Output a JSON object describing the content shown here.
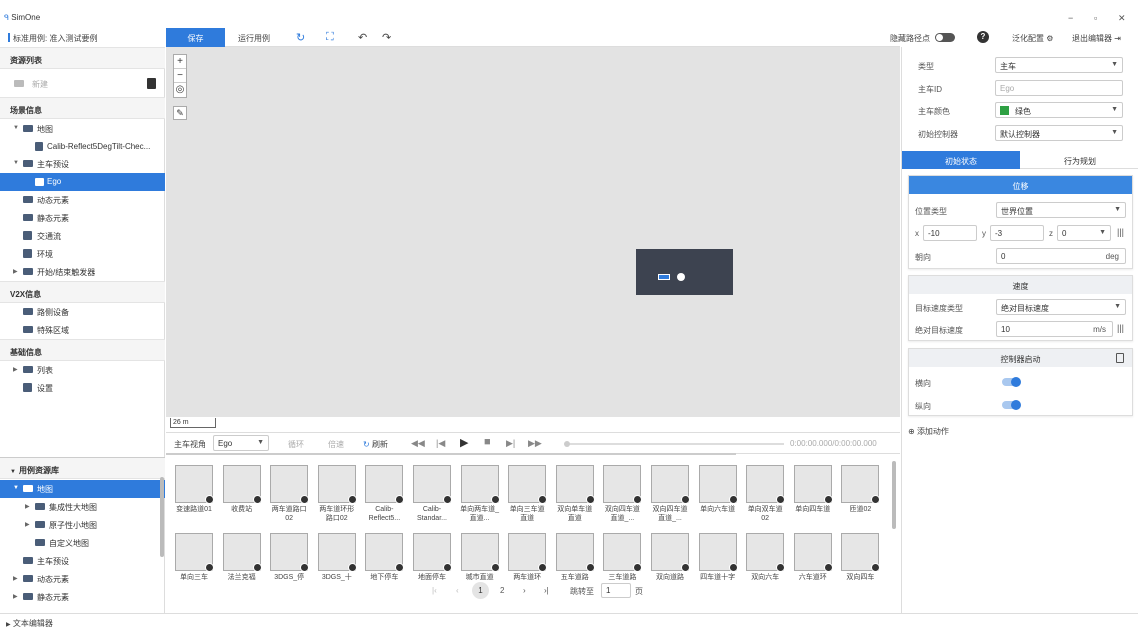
{
  "app": {
    "title": "SimOne",
    "breadcrumb": "标准用例: 准入测试要例"
  },
  "window": {
    "minimize": "−",
    "restore": "▫",
    "close": "✕"
  },
  "toolbar": {
    "save": "保存",
    "run_case": "运行用例"
  },
  "topright": {
    "hide_path_points": "隐藏路径点",
    "help": "?",
    "generalize": "泛化配置",
    "exit": "退出编辑器"
  },
  "sidebar": {
    "resources_title": "资源列表",
    "new": "新建",
    "scene_info": "场景信息",
    "map": "地图",
    "map_file": "Calib-Reflect5DegTilt-Chec...",
    "ego_config": "主车预设",
    "ego": "Ego",
    "dynamic": "动态元素",
    "static": "静态元素",
    "traffic": "交通流",
    "env": "环境",
    "trigger": "开始/结束触发器",
    "v2x": "V2X信息",
    "roadside": "路侧设备",
    "special_zone": "特殊区域",
    "basic": "基础信息",
    "list": "列表",
    "settings": "设置"
  },
  "library": {
    "title": "用例资源库",
    "map": "地图",
    "large_map": "集成性大地图",
    "small_map": "原子性小地图",
    "custom_map": "自定义地图",
    "ego_preset": "主车预设",
    "dynamic": "动态元素",
    "static": "静态元素"
  },
  "player": {
    "main_view_label": "主车视角",
    "main_view_value": "Ego",
    "loop": "循环",
    "speed": "倍速",
    "refresh": "刷新",
    "time": "0:00:00.000/0:00:00.000"
  },
  "scale": "26 m",
  "assets_row1": [
    {
      "label": "变速路道01"
    },
    {
      "label": "收费站"
    },
    {
      "label": "两车道路口02"
    },
    {
      "label": "两车道环形路口02"
    },
    {
      "label": "Calib-Reflect5..."
    },
    {
      "label": "Calib-Standar..."
    },
    {
      "label": "单向两车道_直道..."
    },
    {
      "label": "单向三车道直道"
    },
    {
      "label": "双向单车道直道"
    },
    {
      "label": "双向四车道直道_..."
    },
    {
      "label": "双向四车道直道_..."
    },
    {
      "label": "单向六车道"
    },
    {
      "label": "单向双车道02"
    },
    {
      "label": "单向四车道"
    },
    {
      "label": "匝道02"
    }
  ],
  "assets_row2": [
    {
      "label": "单向三车"
    },
    {
      "label": "法兰克福"
    },
    {
      "label": "3DGS_停"
    },
    {
      "label": "3DGS_十"
    },
    {
      "label": "地下停车"
    },
    {
      "label": "地面停车"
    },
    {
      "label": "城市直道"
    },
    {
      "label": "两车道环"
    },
    {
      "label": "五车道路"
    },
    {
      "label": "三车道路"
    },
    {
      "label": "双向道路"
    },
    {
      "label": "四车道十字"
    },
    {
      "label": "双向六车"
    },
    {
      "label": "六车道环"
    },
    {
      "label": "双向四车"
    }
  ],
  "pager": {
    "first": "|‹",
    "prev": "‹",
    "page1": "1",
    "page2": "2",
    "next": "›",
    "last": "›|",
    "jump_label": "跳转至",
    "jump_value": "1",
    "page_unit": "页"
  },
  "right": {
    "type_label": "类型",
    "type_value": "主车",
    "id_label": "主车ID",
    "id_placeholder": "Ego",
    "color_label": "主车颜色",
    "color_value": "绿色",
    "color_hex": "#2ea043",
    "controller_label": "初始控制器",
    "controller_value": "默认控制器",
    "tab_initial": "初始状态",
    "tab_behavior": "行为规划",
    "pos_title": "位移",
    "pos_type_label": "位置类型",
    "pos_type_value": "世界位置",
    "x_label": "x",
    "x_value": "-10",
    "y_label": "y",
    "y_value": "-3",
    "z_label": "z",
    "z_value": "0",
    "heading_label": "朝向",
    "heading_value": "0",
    "heading_unit": "deg",
    "speed_title": "速度",
    "target_speed_type_label": "目标速度类型",
    "target_speed_type_value": "绝对目标速度",
    "abs_speed_label": "绝对目标速度",
    "abs_speed_value": "10",
    "abs_speed_unit": "m/s",
    "ctrl_title": "控制器启动",
    "lateral": "横向",
    "longitudinal": "纵向",
    "add_action": "添加动作"
  },
  "bottom": {
    "text_editor": "文本编辑器"
  }
}
